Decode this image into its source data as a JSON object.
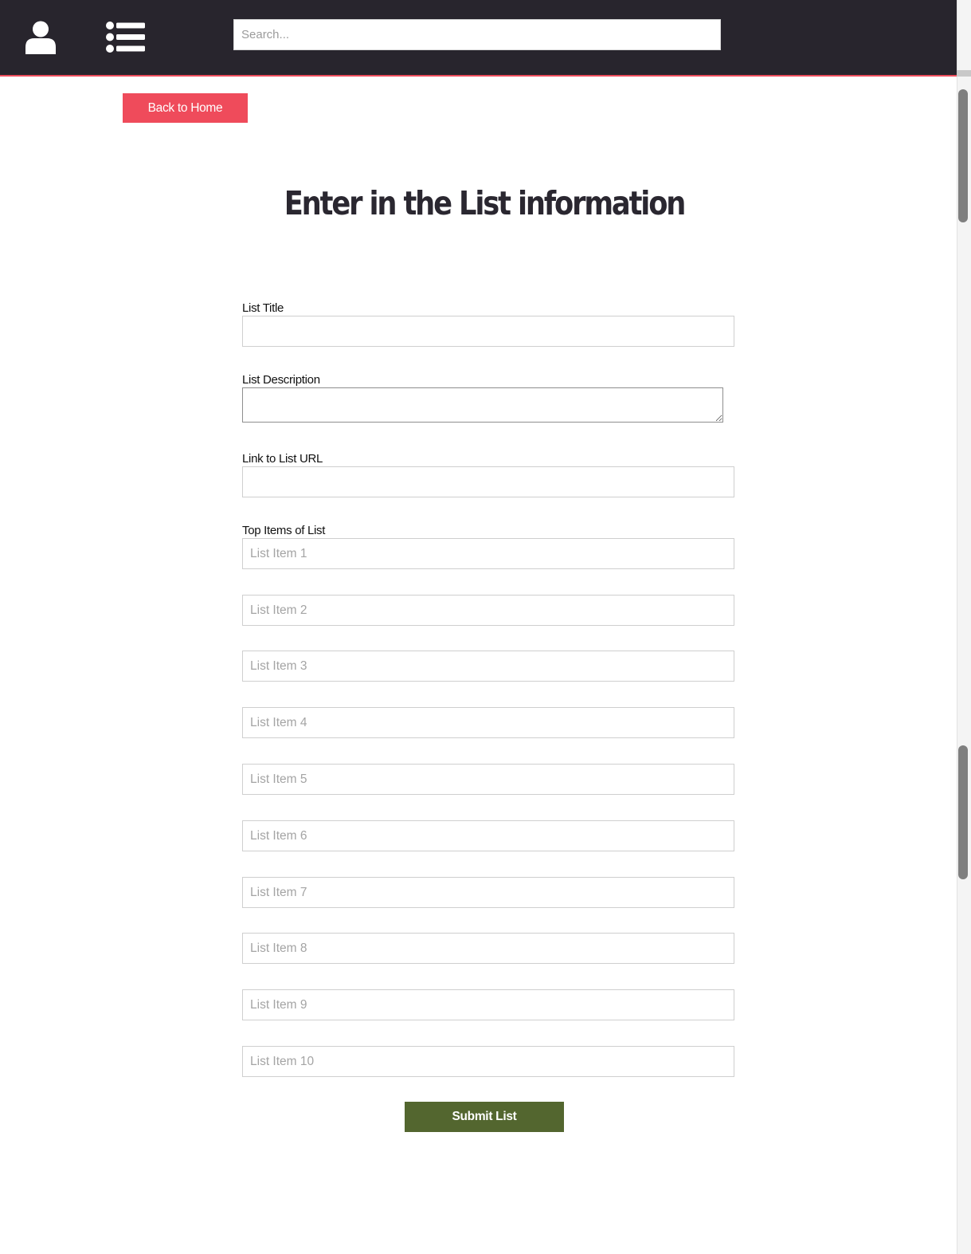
{
  "header": {
    "user_icon": "user-icon",
    "list_icon": "list-icon",
    "search_placeholder": "Search...",
    "accent_color": "#ec4d5c",
    "background_color": "#28252d"
  },
  "back_button": {
    "label": "Back to Home",
    "color": "#ef4b5b"
  },
  "title": "Enter in the List information",
  "form": {
    "list_title_label": "List Title",
    "list_description_label": "List Description",
    "link_url_label": "Link to List URL",
    "top_items_label": "Top Items of List",
    "items": [
      {
        "placeholder": "List Item 1"
      },
      {
        "placeholder": "List Item 2"
      },
      {
        "placeholder": "List Item 3"
      },
      {
        "placeholder": "List Item 4"
      },
      {
        "placeholder": "List Item 5"
      },
      {
        "placeholder": "List Item 6"
      },
      {
        "placeholder": "List Item 7"
      },
      {
        "placeholder": "List Item 8"
      },
      {
        "placeholder": "List Item 9"
      },
      {
        "placeholder": "List Item 10"
      }
    ],
    "submit_label": "Submit List",
    "submit_color": "#53662f"
  }
}
